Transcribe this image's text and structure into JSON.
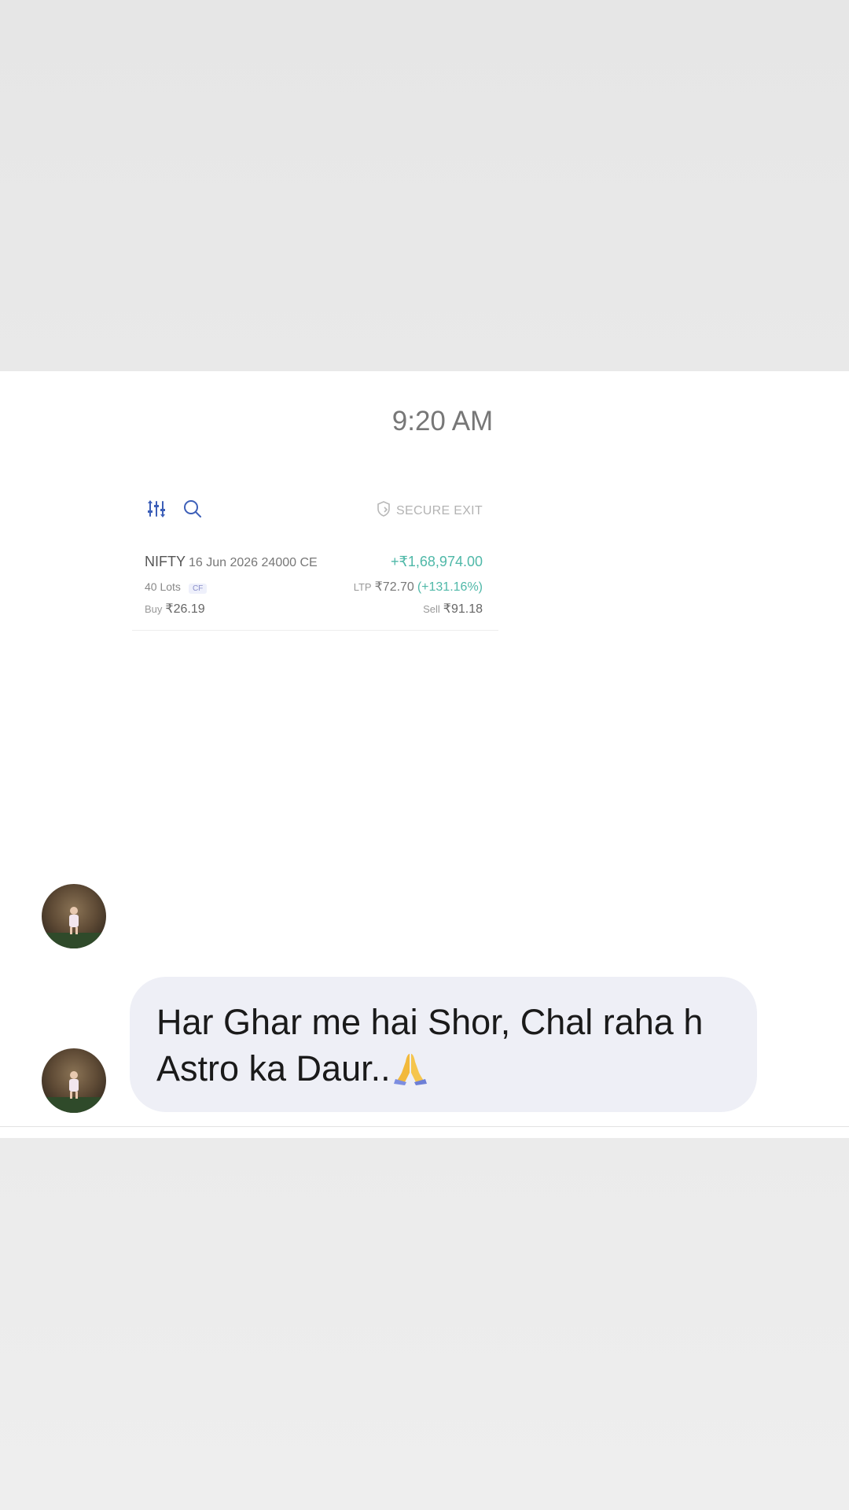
{
  "chat": {
    "timestamp": "9:20 AM"
  },
  "position_card": {
    "toolbar": {
      "filter_icon": "filter-sliders-icon",
      "search_icon": "search-icon",
      "secure_exit_icon": "shield-icon",
      "secure_exit_label": "SECURE EXIT"
    },
    "symbol": "NIFTY",
    "contract": "16 Jun 2026 24000 CE",
    "pnl": "+₹1,68,974.00",
    "lots": "40 Lots",
    "badge": "CF",
    "ltp_label": "LTP",
    "ltp_value": "₹72.70",
    "ltp_change": "(+131.16%)",
    "buy_label": "Buy",
    "buy_value": "₹26.19",
    "sell_label": "Sell",
    "sell_value": "₹91.18"
  },
  "message": {
    "text": "Har Ghar me hai Shor, Chal raha h Astro ka Daur..",
    "emoji": "folded-hands-icon"
  },
  "colors": {
    "profit_green": "#4fb8a8",
    "bubble_bg": "#eeeff6",
    "filter_icon_blue": "#3d5fb8"
  }
}
